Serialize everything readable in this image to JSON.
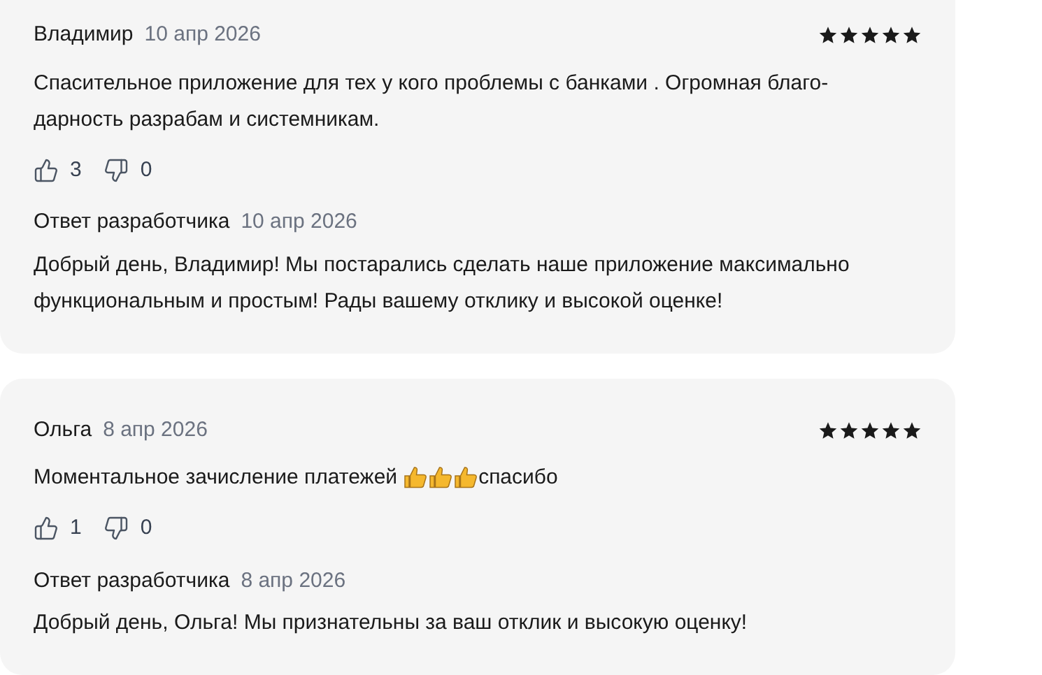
{
  "reviews": [
    {
      "author": "Владимир",
      "date": "10 апр 2026",
      "stars": 5,
      "text": [
        {
          "kind": "text",
          "text": "Спасительное приложение для тех у кого проблемы с банками . Огромная благо-дарность разрабам и системникам."
        }
      ],
      "likes": "3",
      "dislikes": "0",
      "reply": {
        "title": "Ответ разработчика",
        "date": "10 апр 2026",
        "text": "Добрый день, Владимир! Мы постарались сделать наше приложение максимально функциональным и простым! Рады вашему отклику и высокой оценке!"
      }
    },
    {
      "author": "Ольга",
      "date": "8 апр 2026",
      "stars": 5,
      "text": [
        {
          "kind": "text",
          "text": "Моментальное зачисление платежей"
        },
        {
          "kind": "emoji"
        },
        {
          "kind": "emoji"
        },
        {
          "kind": "emoji"
        },
        {
          "kind": "text",
          "text": "спасибо"
        }
      ],
      "likes": "1",
      "dislikes": "0",
      "reply": {
        "title": "Ответ разработчика",
        "date": "8 апр 2026",
        "text": "Добрый день, Ольга! Мы признательны за ваш отклик и высокую оценку!"
      }
    }
  ]
}
